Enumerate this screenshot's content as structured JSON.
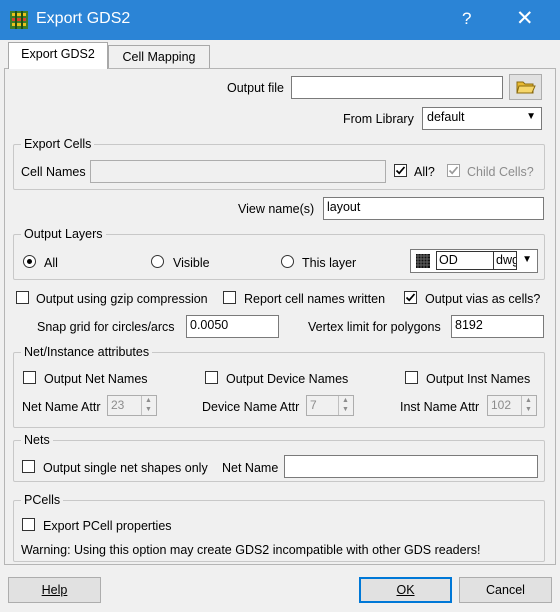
{
  "window": {
    "title": "Export GDS2",
    "help_glyph": "?",
    "close_glyph": "✕"
  },
  "tabs": [
    {
      "label": "Export GDS2"
    },
    {
      "label": "Cell Mapping"
    }
  ],
  "output_file": {
    "label": "Output file",
    "value": ""
  },
  "from_library": {
    "label": "From Library",
    "value": "default"
  },
  "export_cells": {
    "title": "Export Cells",
    "cell_names_label": "Cell Names",
    "cell_names_value": "",
    "all_label": "All?",
    "child_cells_label": "Child Cells?"
  },
  "view_name": {
    "label": "View name(s)",
    "value": "layout"
  },
  "output_layers": {
    "title": "Output Layers",
    "options": [
      {
        "label": "All"
      },
      {
        "label": "Visible"
      },
      {
        "label": "This layer"
      }
    ],
    "layer_name": "OD",
    "layer_purpose": "dwg"
  },
  "options": {
    "gzip_label": "Output using gzip compression",
    "report_label": "Report cell names written",
    "vias_label": "Output vias as cells?"
  },
  "snap_grid": {
    "label": "Snap grid for circles/arcs",
    "value": "0.0050"
  },
  "vertex_limit": {
    "label": "Vertex limit for polygons",
    "value": "8192"
  },
  "net_instance": {
    "title": "Net/Instance attributes",
    "net_names_label": "Output Net Names",
    "device_names_label": "Output Device Names",
    "inst_names_label": "Output Inst Names",
    "net_attr_label": "Net Name Attr",
    "net_attr_value": "23",
    "device_attr_label": "Device Name Attr",
    "device_attr_value": "7",
    "inst_attr_label": "Inst Name Attr",
    "inst_attr_value": "102"
  },
  "nets": {
    "title": "Nets",
    "single_label": "Output single net shapes only",
    "net_name_label": "Net Name",
    "net_name_value": ""
  },
  "pcells": {
    "title": "PCells",
    "export_label": "Export PCell properties",
    "warning": "Warning: Using this option may create GDS2 incompatible with other GDS readers!"
  },
  "buttons": {
    "help": "Help",
    "ok": "OK",
    "cancel": "Cancel"
  },
  "colors": {
    "titlebar": "#2b84d6",
    "accent": "#0078d7"
  }
}
